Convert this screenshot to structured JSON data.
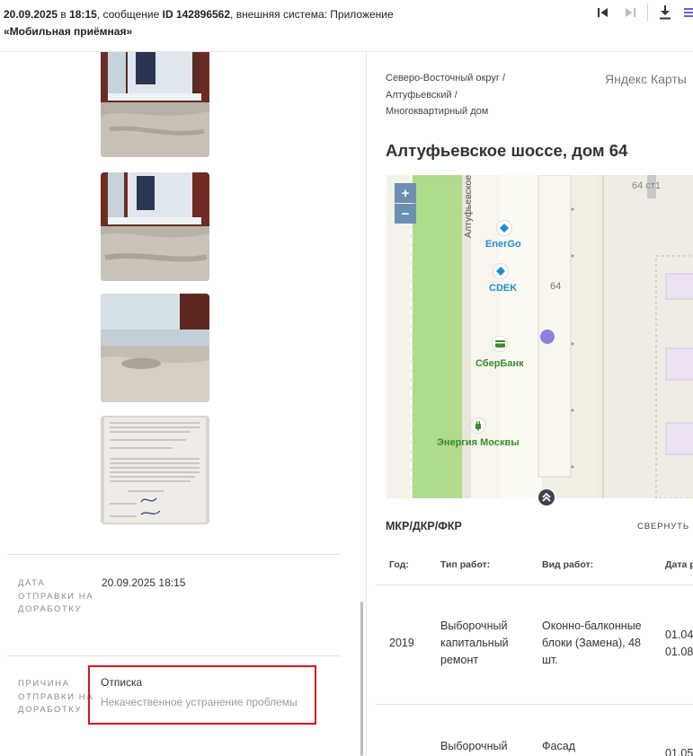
{
  "header": {
    "date": "20.09.2025",
    "word_in": "в",
    "time": "18:15",
    "message_prefix": ", сообщение",
    "message_id": "ID 142896562",
    "system_text": ", внешняя система: Приложение",
    "app_name": "«Мобильная приёмная»",
    "icons": [
      "skip-first-icon",
      "skip-last-icon",
      "download-icon",
      "menu-icon"
    ]
  },
  "photos": [
    "photo-1",
    "photo-2",
    "photo-3",
    "photo-4"
  ],
  "details": {
    "send_date_label": "ДАТА ОТПРАВКИ НА ДОРАБОТКУ",
    "send_date_value": "20.09.2025 18:15",
    "reason_label": "ПРИЧИНА ОТПРАВКИ НА ДОРАБОТКУ",
    "reason_title": "Отписка",
    "reason_detail": "Некачественное устранение проблемы"
  },
  "location": {
    "breadcrumbs": [
      "Северо-Восточный округ /",
      "Алтуфьевский /",
      "Многоквартирный дом"
    ],
    "yandex_label": "Яндекс Карты",
    "address": "Алтуфьевское шоссе, дом 64"
  },
  "map": {
    "street": "Алтуфьевское ш.",
    "poi": [
      "EnerGo",
      "CDEK",
      "СберБанк",
      "Энергия Москвы"
    ],
    "house_number": "64",
    "building_label": "64 ст1",
    "zoom_in": "+",
    "zoom_out": "−",
    "colors": {
      "park": "#aedb8c",
      "accent": "#8e7fe0",
      "poi_blue": "#1a8fd6",
      "poi_green": "#3b8c2a"
    }
  },
  "works": {
    "title": "МКР/ДКР/ФКР",
    "collapse_label": "СВЕРНУТЬ",
    "columns": [
      "Год:",
      "Тип работ:",
      "Вид работ:",
      "Дата р"
    ],
    "rows": [
      {
        "year": "2019",
        "type": "Выборочный капитальный ремонт",
        "kind": "Оконно-балконные блоки (Замена), 48 шт.",
        "dates": [
          "01.04",
          "01.08"
        ]
      },
      {
        "year": "",
        "type": "Выборочный",
        "kind": "Фасад",
        "dates": [
          "01.05"
        ]
      }
    ]
  }
}
